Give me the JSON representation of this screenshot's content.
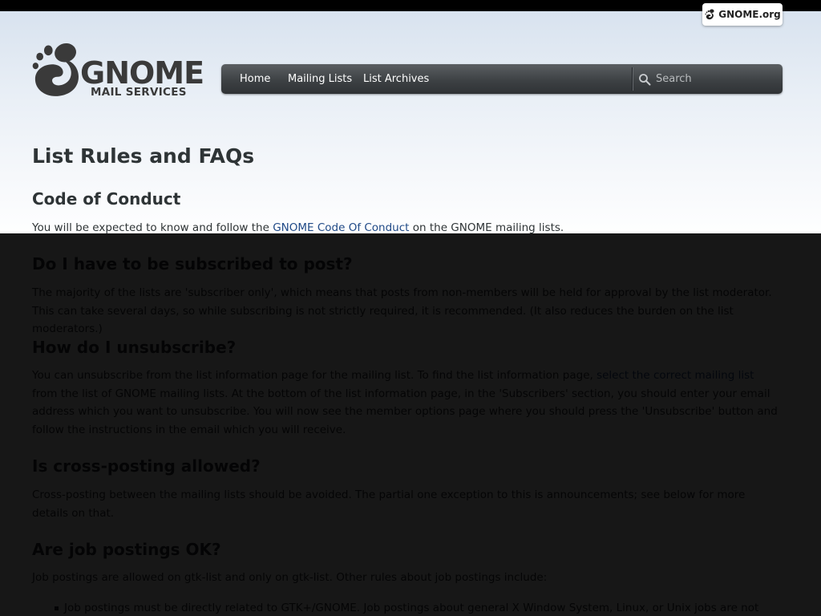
{
  "header": {
    "badge_label": "GNOME.org",
    "logo_wordmark": "GNOME",
    "logo_subtitle": "MAIL SERVICES"
  },
  "nav": {
    "items": [
      {
        "label": "Home"
      },
      {
        "label": "Mailing Lists"
      },
      {
        "label": "List Archives"
      }
    ],
    "search_placeholder": "Search"
  },
  "page": {
    "title": "List Rules and FAQs",
    "sections": [
      {
        "heading": "Code of Conduct",
        "text_before": "You will be expected to know and follow the ",
        "link": "GNOME Code Of Conduct",
        "text_after": " on the GNOME mailing lists."
      },
      {
        "heading": "Do I have to be subscribed to post?",
        "text": "The majority of the lists are 'subscriber only', which means that posts from non-members will be held for approval by the list moderator. This can take several days, so while subscribing is not strictly required, it is recommended. (It also reduces the burden on the list moderators.)"
      },
      {
        "heading": "How do I unsubscribe?",
        "text_before": "You can unsubscribe from the list information page for the mailing list. To find the list information page, ",
        "link": "select the correct mailing list",
        "text_after": " from the list of GNOME mailing lists. At the bottom of the list information page, in the 'Subscribers' section, you should enter your email address which you want to unsubscribe. You will now see the member options page where you should press the 'Unsubscribe' button and follow the instructions in the email which you will receive."
      },
      {
        "heading": "Is cross-posting allowed?",
        "text": "Cross-posting between the mailing lists should be avoided. The partial one exception to this is announcements; see below for more details on that."
      },
      {
        "heading": "Are job postings OK?",
        "text": "Job postings are allowed on gtk-list and only on gtk-list. Other rules about job postings include:",
        "bullets": [
          "Job postings must be directly related to GTK+/GNOME. Job postings about general X Window System, Linux, or Unix jobs are not acceptable."
        ]
      }
    ]
  },
  "colors": {
    "link": "#204a87",
    "text": "#2e3436",
    "navbar": "#3d4144",
    "overlay": "rgba(0,0,0,0.91)"
  }
}
